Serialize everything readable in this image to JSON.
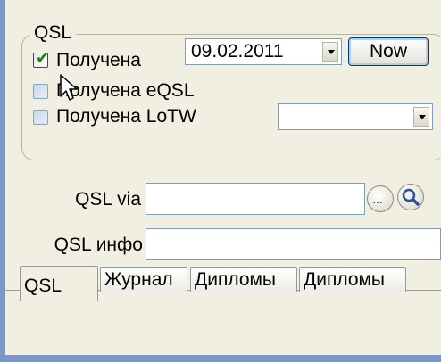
{
  "qsl_group": {
    "title": "QSL",
    "received": {
      "label": "Получена",
      "checked": true
    },
    "received_date": {
      "value": "09.02.2011"
    },
    "now_button": {
      "label": "Now"
    },
    "received_eqsl": {
      "label": "Получена eQSL",
      "checked": false,
      "enabled": false
    },
    "received_lotw": {
      "label": "Получена LoTW",
      "checked": false,
      "enabled": false
    },
    "lotw_combo": {
      "value": ""
    }
  },
  "qsl_via": {
    "label": "QSL via",
    "value": ""
  },
  "qsl_info": {
    "label": "QSL инфо",
    "value": ""
  },
  "tabs": [
    {
      "label": "QSL",
      "active": true
    },
    {
      "label": "Журнал",
      "active": false
    },
    {
      "label": "Дипломы",
      "active": false
    },
    {
      "label": "Дипломы",
      "active": false
    }
  ],
  "colors": {
    "window_bg": "#f1efe2",
    "window_frame": "#7b96c9",
    "check_green": "#1e7b1e"
  },
  "icons": {
    "dots_button": "ellipsis-icon",
    "search_button": "magnifier-icon",
    "dropdown": "chevron-down-icon",
    "cursor": "mouse-pointer-icon"
  }
}
